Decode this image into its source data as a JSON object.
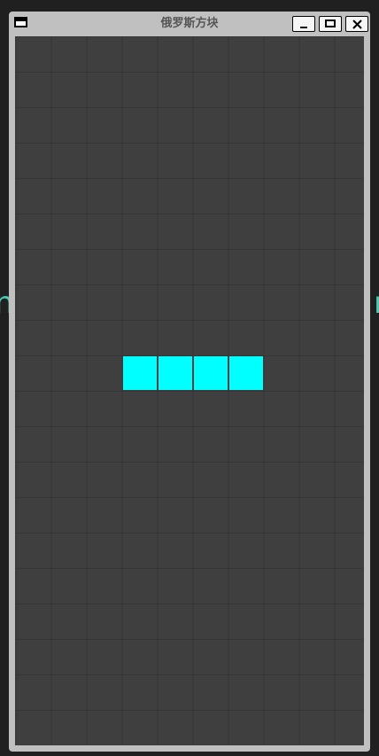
{
  "window": {
    "title": "俄罗斯方块",
    "icon": "window-menu-icon",
    "buttons": [
      "minimize-icon",
      "maximize-icon",
      "close-icon"
    ]
  },
  "background": {
    "left_glyph": "n",
    "right_glyph": "r",
    "glyph_color": "#4ec9b0"
  },
  "board": {
    "columns": 10,
    "rows": 20,
    "background_color": "#3f3f3f",
    "grid_color": "#353535",
    "active_piece": {
      "type": "I",
      "color": "#00ffff",
      "cells": [
        [
          3,
          9
        ],
        [
          4,
          9
        ],
        [
          5,
          9
        ],
        [
          6,
          9
        ]
      ]
    }
  }
}
